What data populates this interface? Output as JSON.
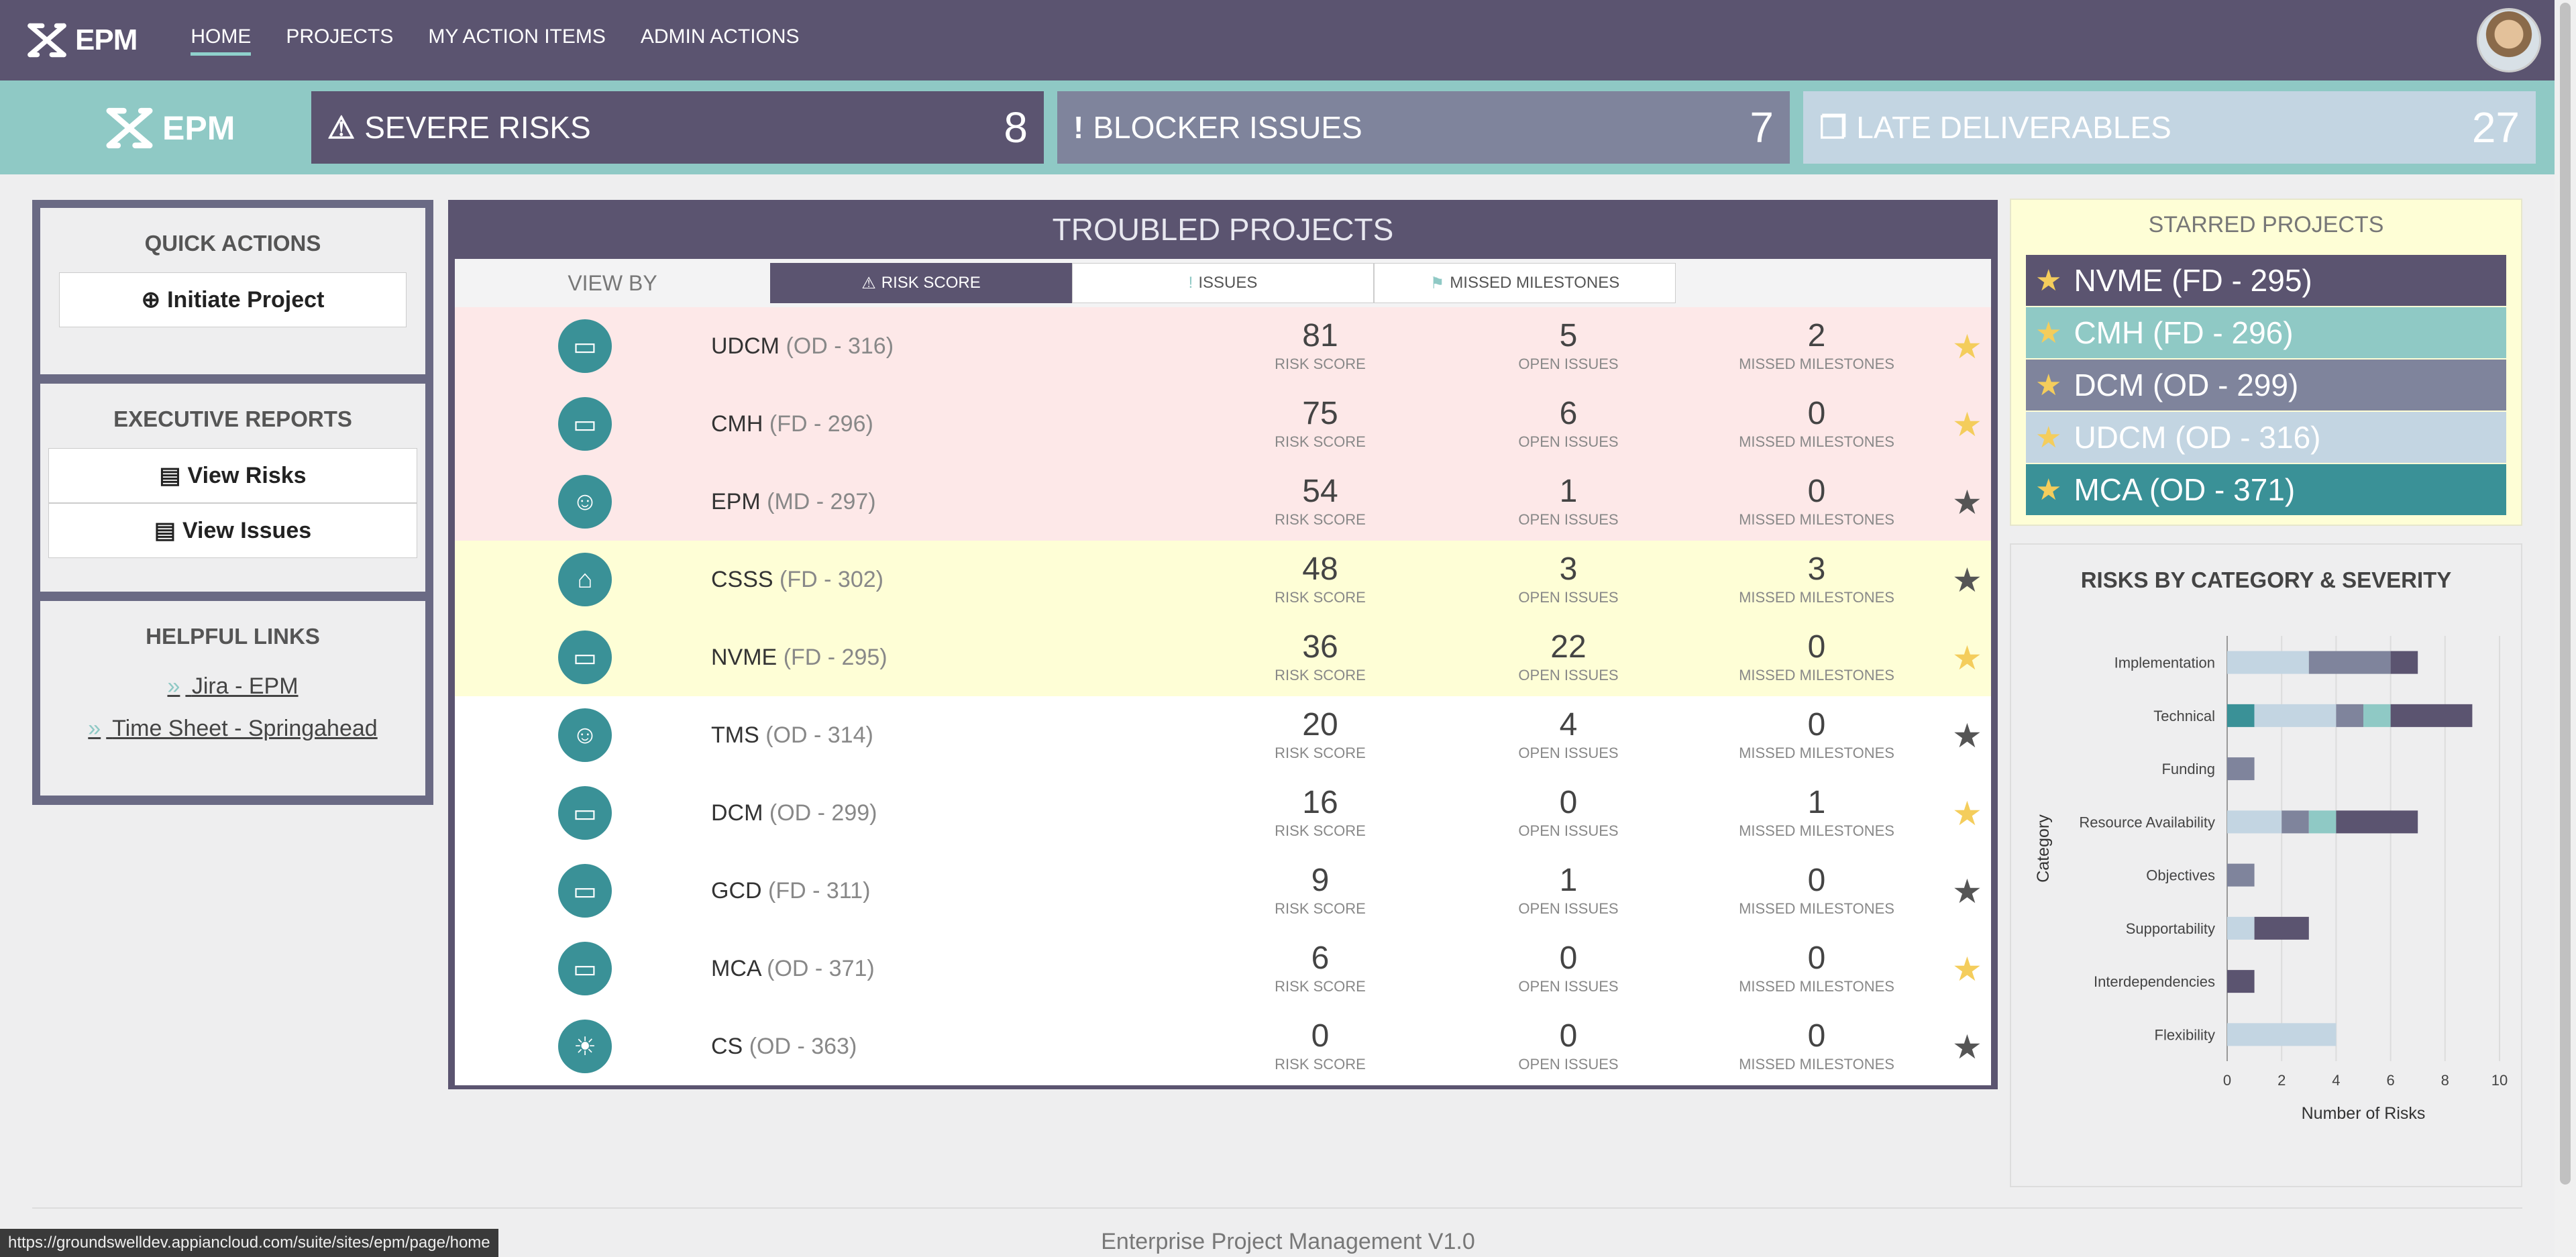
{
  "nav": {
    "logo_text": "EPM",
    "links": [
      "HOME",
      "PROJECTS",
      "MY ACTION ITEMS",
      "ADMIN ACTIONS"
    ]
  },
  "kpis": [
    {
      "icon": "warning-icon",
      "label": "SEVERE RISKS",
      "value": "8"
    },
    {
      "icon": "exclamation-icon",
      "label": "BLOCKER ISSUES",
      "value": "7"
    },
    {
      "icon": "documents-icon",
      "label": "LATE DELIVERABLES",
      "value": "27"
    }
  ],
  "sidebar": {
    "quick_actions": {
      "title": "QUICK ACTIONS",
      "button": "Initiate Project"
    },
    "exec_reports": {
      "title": "EXECUTIVE REPORTS",
      "buttons": [
        "View Risks",
        "View Issues"
      ]
    },
    "links": {
      "title": "HELPFUL LINKS",
      "items": [
        "Jira - EPM",
        "Time Sheet - Springahead"
      ]
    }
  },
  "troubled": {
    "title": "TROUBLED PROJECTS",
    "view_by": "VIEW BY",
    "tabs": [
      "RISK SCORE",
      "ISSUES",
      "MISSED MILESTONES"
    ],
    "metric_labels": [
      "RISK SCORE",
      "OPEN ISSUES",
      "MISSED MILESTONES"
    ],
    "rows": [
      {
        "name": "UDCM",
        "code": "(OD - 316)",
        "risk": "81",
        "issues": "5",
        "milestones": "2",
        "starred": true,
        "icon": "laptop-icon"
      },
      {
        "name": "CMH",
        "code": "(FD - 296)",
        "risk": "75",
        "issues": "6",
        "milestones": "0",
        "starred": true,
        "icon": "laptop-icon"
      },
      {
        "name": "EPM",
        "code": "(MD - 297)",
        "risk": "54",
        "issues": "1",
        "milestones": "0",
        "starred": false,
        "icon": "user-icon"
      },
      {
        "name": "CSSS",
        "code": "(FD - 302)",
        "risk": "48",
        "issues": "3",
        "milestones": "3",
        "starred": false,
        "icon": "bank-icon"
      },
      {
        "name": "NVME",
        "code": "(FD - 295)",
        "risk": "36",
        "issues": "22",
        "milestones": "0",
        "starred": true,
        "icon": "laptop-icon"
      },
      {
        "name": "TMS",
        "code": "(OD - 314)",
        "risk": "20",
        "issues": "4",
        "milestones": "0",
        "starred": false,
        "icon": "user-icon"
      },
      {
        "name": "DCM",
        "code": "(OD - 299)",
        "risk": "16",
        "issues": "0",
        "milestones": "1",
        "starred": true,
        "icon": "laptop-icon"
      },
      {
        "name": "GCD",
        "code": "(FD - 311)",
        "risk": "9",
        "issues": "1",
        "milestones": "0",
        "starred": false,
        "icon": "laptop-icon"
      },
      {
        "name": "MCA",
        "code": "(OD - 371)",
        "risk": "6",
        "issues": "0",
        "milestones": "0",
        "starred": true,
        "icon": "laptop-icon"
      },
      {
        "name": "CS",
        "code": "(OD - 363)",
        "risk": "0",
        "issues": "0",
        "milestones": "0",
        "starred": false,
        "icon": "lightbulb-icon"
      }
    ]
  },
  "starred": {
    "title": "STARRED PROJECTS",
    "items": [
      {
        "label": "NVME (FD - 295)",
        "color": "#5b5470"
      },
      {
        "label": "CMH (FD - 296)",
        "color": "#8fc9c5"
      },
      {
        "label": "DCM (OD - 299)",
        "color": "#7f849c"
      },
      {
        "label": "UDCM (OD - 316)",
        "color": "#c3d5e2"
      },
      {
        "label": "MCA (OD - 371)",
        "color": "#3a9197"
      }
    ]
  },
  "chart_data": {
    "type": "bar",
    "orientation": "horizontal",
    "stacked": true,
    "title": "RISKS BY CATEGORY & SEVERITY",
    "xlabel": "Number of Risks",
    "ylabel": "Category",
    "xlim": [
      0,
      10
    ],
    "xticks": [
      "0",
      "2",
      "4",
      "6",
      "8",
      "10"
    ],
    "grid": true,
    "categories": [
      "Implementation",
      "Technical",
      "Funding",
      "Resource Availability",
      "Objectives",
      "Supportability",
      "Interdependencies",
      "Flexibility"
    ],
    "series": [
      {
        "color": "#3a9197",
        "values": [
          0,
          1,
          0,
          0,
          0,
          0,
          0,
          0
        ]
      },
      {
        "color": "#c3d5e2",
        "values": [
          3,
          3,
          0,
          2,
          0,
          1,
          0,
          4
        ]
      },
      {
        "color": "#7f849c",
        "values": [
          3,
          1,
          1,
          1,
          1,
          0,
          0,
          0
        ]
      },
      {
        "color": "#8fc9c5",
        "values": [
          0,
          1,
          0,
          1,
          0,
          0,
          0,
          0
        ]
      },
      {
        "color": "#5b5470",
        "values": [
          1,
          3,
          0,
          3,
          0,
          2,
          1,
          0
        ]
      }
    ]
  },
  "footer": {
    "text": "Enterprise Project Management V1.0",
    "status_url": "https://groundswelldev.appiancloud.com/suite/sites/epm/page/home"
  }
}
